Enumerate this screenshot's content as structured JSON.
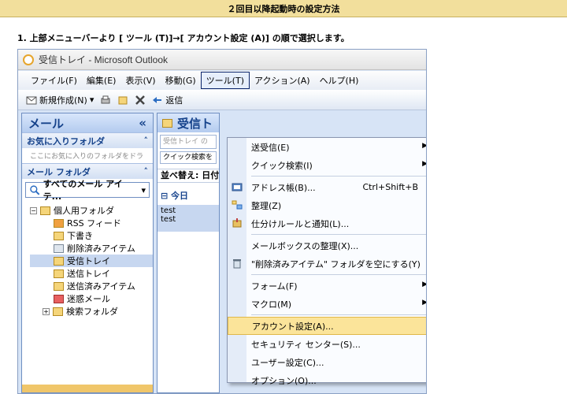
{
  "header": {
    "title": "２回目以降起動時の設定方法"
  },
  "instruction": "1. 上部メニューバーより [ ツール (T)]→[ アカウント設定 (A)] の順で選択します。",
  "window": {
    "title": "受信トレイ - Microsoft Outlook"
  },
  "menubar": [
    "ファイル(F)",
    "編集(E)",
    "表示(V)",
    "移動(G)",
    "ツール(T)",
    "アクション(A)",
    "ヘルプ(H)"
  ],
  "toolbar": {
    "new": "新規作成(N)",
    "reply": "返信"
  },
  "nav": {
    "title": "メール",
    "favorites": "お気に入りフォルダ",
    "favorites_hint": "ここにお気に入りのフォルダをドラ",
    "mail_folders": "メール フォルダ",
    "all_items": "すべてのメール アイテ...",
    "tree": [
      "個人用フォルダ",
      "RSS フィード",
      "下書き",
      "削除済みアイテム",
      "受信トレイ",
      "送信トレイ",
      "送信済みアイテム",
      "迷惑メール",
      "検索フォルダ"
    ]
  },
  "mid": {
    "title": "受信ト",
    "search": "受信トレイ の",
    "quick": "クイック検索を",
    "sort": "並べ替え: 日付",
    "group": "今日",
    "item1": "test",
    "item2": "test"
  },
  "menu": {
    "items": [
      {
        "label": "送受信(E)"
      },
      {
        "label": "クイック検索(I)"
      },
      {
        "label": "アドレス帳(B)...",
        "shortcut": "Ctrl+Shift+B"
      },
      {
        "label": "整理(Z)"
      },
      {
        "label": "仕分けルールと通知(L)..."
      },
      {
        "label": "メールボックスの整理(X)..."
      },
      {
        "label": "\"削除済みアイテム\" フォルダを空にする(Y)"
      },
      {
        "label": "フォーム(F)"
      },
      {
        "label": "マクロ(M)"
      },
      {
        "label": "アカウント設定(A)..."
      },
      {
        "label": "セキュリティ センター(S)..."
      },
      {
        "label": "ユーザー設定(C)..."
      },
      {
        "label": "オプション(O)..."
      }
    ]
  },
  "colors": {
    "header_bg": "#f2df9c",
    "highlight": "#fbe49a",
    "nav_head": "#b4cbef"
  }
}
